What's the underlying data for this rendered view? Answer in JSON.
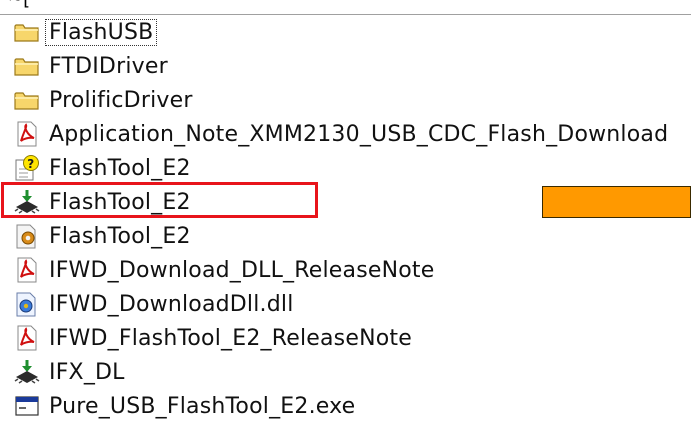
{
  "header": {
    "cut_text": "~["
  },
  "files": [
    {
      "name": "FlashUSB",
      "icon": "folder-icon",
      "focused": true
    },
    {
      "name": "FTDIDriver",
      "icon": "folder-icon"
    },
    {
      "name": "ProlificDriver",
      "icon": "folder-icon"
    },
    {
      "name": "Application_Note_XMM2130_USB_CDC_Flash_Download",
      "icon": "pdf-icon"
    },
    {
      "name": "FlashTool_E2",
      "icon": "help-file-icon"
    },
    {
      "name": "FlashTool_E2",
      "icon": "chip-app-icon",
      "highlighted": true
    },
    {
      "name": "FlashTool_E2",
      "icon": "config-file-icon"
    },
    {
      "name": "IFWD_Download_DLL_ReleaseNote",
      "icon": "pdf-icon"
    },
    {
      "name": "IFWD_DownloadDll.dll",
      "icon": "dll-icon"
    },
    {
      "name": "IFWD_FlashTool_E2_ReleaseNote",
      "icon": "pdf-icon"
    },
    {
      "name": "IFX_DL",
      "icon": "chip-app-icon"
    },
    {
      "name": "Pure_USB_FlashTool_E2.exe",
      "icon": "exe-window-icon"
    }
  ],
  "annotation": {
    "highlight_color": "#e8141b",
    "marker_color": "#ff9900"
  }
}
